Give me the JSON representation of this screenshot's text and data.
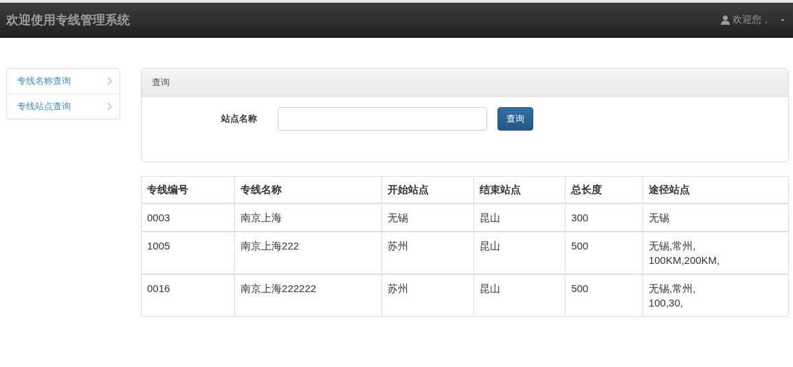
{
  "navbar": {
    "title": "欢迎使用专线管理系统",
    "user": "欢迎您，"
  },
  "sidebar": {
    "items": [
      {
        "label": "专线名称查询"
      },
      {
        "label": "专线站点查询"
      }
    ]
  },
  "search_panel": {
    "heading": "查询",
    "field_label": "站点名称",
    "button": "查询"
  },
  "table": {
    "columns": [
      "专线编号",
      "专线名称",
      "开始站点",
      "结束站点",
      "总长度",
      "途径站点"
    ],
    "rows": [
      [
        "0003",
        "南京上海",
        "无锡",
        "昆山",
        "300",
        "无锡"
      ],
      [
        "1005",
        "南京上海222",
        "苏州",
        "昆山",
        "500",
        "无锡,常州,\n100KM,200KM,"
      ],
      [
        "0016",
        "南京上海222222",
        "苏州",
        "昆山",
        "500",
        "无锡,常州,\n100,30,"
      ]
    ]
  }
}
